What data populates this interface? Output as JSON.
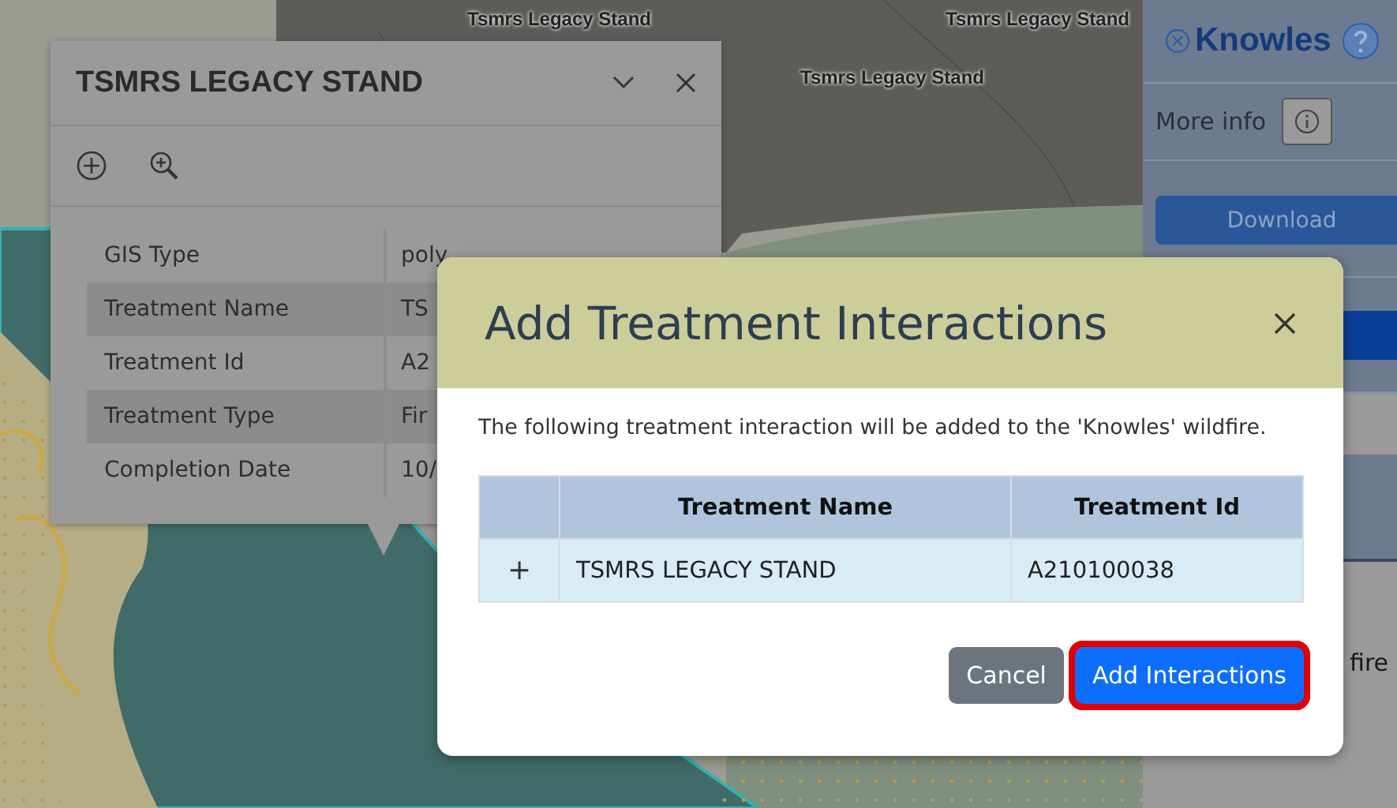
{
  "map": {
    "labels": [
      "Tsmrs Legacy Stand",
      "Tsmrs Legacy Stand",
      "Tsmrs Legacy Stand"
    ]
  },
  "feature_popup": {
    "title": "TSMRS LEGACY STAND",
    "rows": [
      {
        "label": "GIS Type",
        "value": "poly"
      },
      {
        "label": "Treatment Name",
        "value": "TS"
      },
      {
        "label": "Treatment Id",
        "value": "A2"
      },
      {
        "label": "Treatment Type",
        "value": "Fir"
      },
      {
        "label": "Completion Date",
        "value": "10/"
      }
    ]
  },
  "side_panel": {
    "title": "Knowles",
    "more_info": "More info",
    "download": "Download",
    "partial_text": "fire"
  },
  "dialog": {
    "title": "Add Treatment Interactions",
    "message": "The following treatment interaction will be added to the 'Knowles' wildfire.",
    "table": {
      "columns": [
        "Treatment Name",
        "Treatment Id"
      ],
      "rows": [
        {
          "expand": "+",
          "treatment_name": "TSMRS LEGACY STAND",
          "treatment_id": "A210100038"
        }
      ]
    },
    "buttons": [
      {
        "label": "Cancel",
        "kind": "secondary",
        "highlighted": false
      },
      {
        "label": "Add Interactions",
        "kind": "primary",
        "highlighted": true
      }
    ]
  }
}
